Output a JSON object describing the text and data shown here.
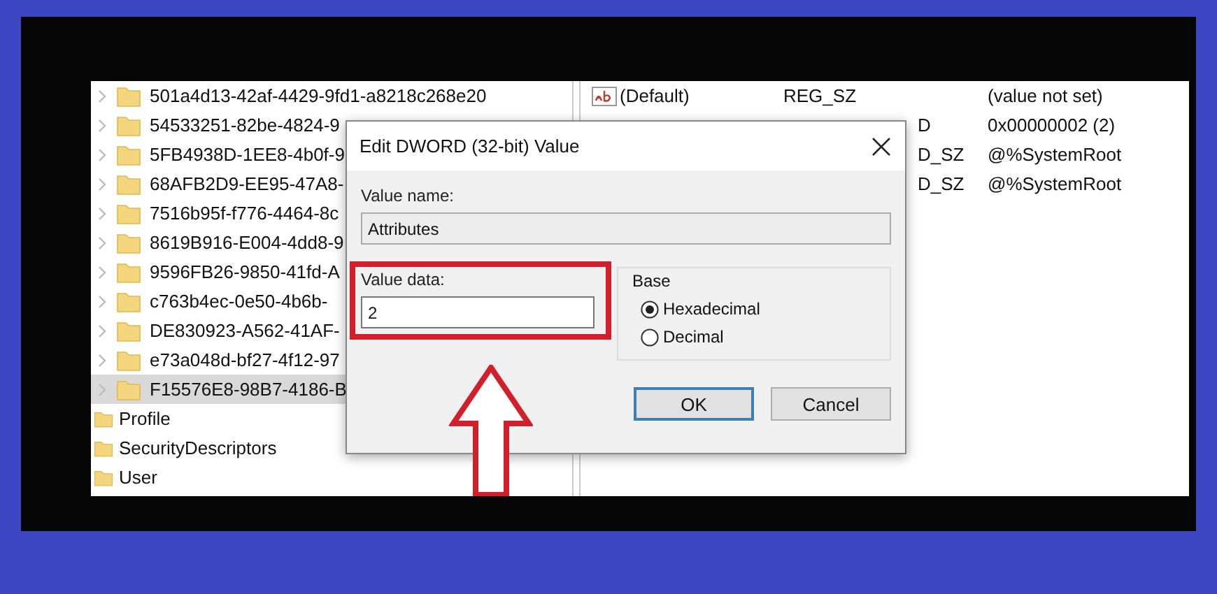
{
  "tree": {
    "items": [
      {
        "label": "501a4d13-42af-4429-9fd1-a8218c268e20",
        "expandable": true,
        "selected": false
      },
      {
        "label": "54533251-82be-4824-9",
        "expandable": true,
        "selected": false
      },
      {
        "label": "5FB4938D-1EE8-4b0f-9",
        "expandable": true,
        "selected": false
      },
      {
        "label": "68AFB2D9-EE95-47A8-",
        "expandable": true,
        "selected": false
      },
      {
        "label": "7516b95f-f776-4464-8c",
        "expandable": true,
        "selected": false
      },
      {
        "label": "8619B916-E004-4dd8-9",
        "expandable": true,
        "selected": false
      },
      {
        "label": "9596FB26-9850-41fd-A",
        "expandable": true,
        "selected": false
      },
      {
        "label": "c763b4ec-0e50-4b6b-",
        "expandable": true,
        "selected": false
      },
      {
        "label": "DE830923-A562-41AF-",
        "expandable": true,
        "selected": false
      },
      {
        "label": "e73a048d-bf27-4f12-97",
        "expandable": true,
        "selected": false
      },
      {
        "label": "F15576E8-98B7-4186-B",
        "expandable": true,
        "selected": true
      },
      {
        "label": "Profile",
        "expandable": false,
        "selected": false
      },
      {
        "label": "SecurityDescriptors",
        "expandable": false,
        "selected": false
      },
      {
        "label": "User",
        "expandable": false,
        "selected": false
      }
    ]
  },
  "values": {
    "rows": [
      {
        "name": "(Default)",
        "type": "REG_SZ",
        "data": "(value not set)"
      },
      {
        "type": "D",
        "data": "0x00000002 (2)"
      },
      {
        "type": "D_SZ",
        "data": "@%SystemRoot"
      },
      {
        "type": "D_SZ",
        "data": "@%SystemRoot"
      }
    ]
  },
  "dialog": {
    "title": "Edit DWORD (32-bit) Value",
    "value_name": {
      "label": "Value name:",
      "value": "Attributes"
    },
    "value_data": {
      "label": "Value data:",
      "value": "2"
    },
    "base": {
      "label": "Base",
      "options": [
        {
          "label": "Hexadecimal",
          "selected": true
        },
        {
          "label": "Decimal",
          "selected": false
        }
      ]
    },
    "buttons": [
      {
        "label": "OK",
        "default": true
      },
      {
        "label": "Cancel",
        "default": false
      }
    ]
  }
}
